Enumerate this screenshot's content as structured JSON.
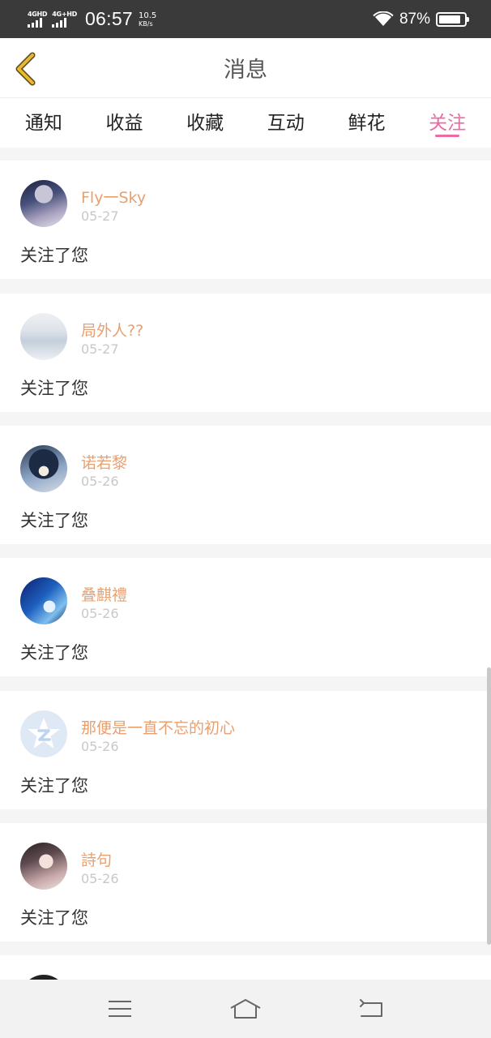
{
  "status_bar": {
    "sim1_label": "4GHD",
    "sim2_label": "4G+HD",
    "time": "06:57",
    "net_speed": "10.5",
    "net_speed_unit": "KB/s",
    "battery_pct": "87%",
    "battery_level": 0.87
  },
  "header": {
    "title": "消息",
    "back_icon": "chevron-left-icon",
    "accent_color": "#e8b82e"
  },
  "tabs": [
    {
      "label": "通知",
      "active": false
    },
    {
      "label": "收益",
      "active": false
    },
    {
      "label": "收藏",
      "active": false
    },
    {
      "label": "互动",
      "active": false
    },
    {
      "label": "鲜花",
      "active": false
    },
    {
      "label": "关注",
      "active": true
    }
  ],
  "active_tab_color": "#e86da4",
  "feed": {
    "items": [
      {
        "username": "Fly一Sky",
        "date": "05-27",
        "message": "关注了您"
      },
      {
        "username": "局外人??",
        "date": "05-27",
        "message": "关注了您"
      },
      {
        "username": "诺若黎",
        "date": "05-26",
        "message": "关注了您"
      },
      {
        "username": "叠麒禮",
        "date": "05-26",
        "message": "关注了您"
      },
      {
        "username": "那便是一直不忘的初心",
        "date": "05-26",
        "message": "关注了您"
      },
      {
        "username": "詩句",
        "date": "05-26",
        "message": "关注了您"
      }
    ]
  },
  "nav_bar": {
    "menu_icon": "menu-icon",
    "home_icon": "home-icon",
    "back_icon": "back-arrow-icon"
  }
}
